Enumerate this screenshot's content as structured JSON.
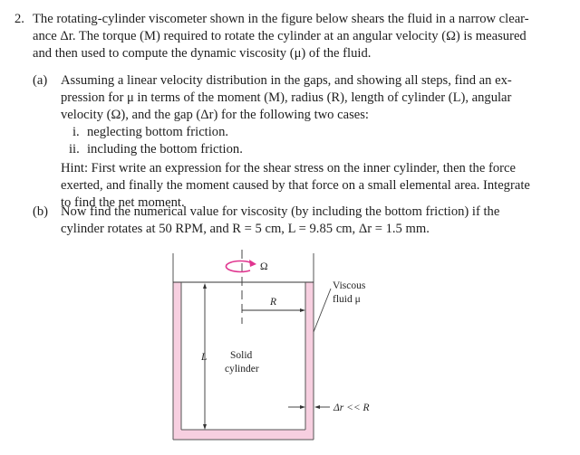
{
  "problem": {
    "number": "2.",
    "intro_lines": [
      "The rotating-cylinder viscometer shown in the figure below shears the fluid in a narrow clear-",
      "ance Δr. The torque (M) required to rotate the cylinder at an angular velocity (Ω) is measured",
      "and then used to compute the dynamic viscosity (μ) of the fluid."
    ],
    "part_a": {
      "label": "(a)",
      "lines": [
        "Assuming a linear velocity distribution in the gaps, and showing all steps, find an ex-",
        "pression for μ in terms of the moment (M), radius (R), length of cylinder (L), angular",
        "velocity (Ω), and the gap (Δr) for the following two cases:"
      ],
      "cases": [
        {
          "label": "i.",
          "text": "neglecting bottom friction."
        },
        {
          "label": "ii.",
          "text": "including the bottom friction."
        }
      ],
      "hint_lines": [
        "Hint: First write an expression for the shear stress on the inner cylinder, then the force",
        "exerted, and finally the moment caused by that force on a small elemental area. Integrate",
        "to find the net moment."
      ]
    },
    "part_b": {
      "label": "(b)",
      "lines": [
        "Now find the numerical value for viscosity (by including the bottom friction) if the",
        "cylinder rotates at 50 RPM, and R = 5 cm, L = 9.85 cm, Δr = 1.5 mm."
      ]
    }
  },
  "figure": {
    "omega_label": "Ω",
    "radius_label": "R",
    "length_label": "L",
    "fluid_label_line1": "Viscous",
    "fluid_label_line2": "fluid μ",
    "cylinder_label_line1": "Solid",
    "cylinder_label_line2": "cylinder",
    "gap_label": "Δr << R",
    "colors": {
      "fluid": "#F7CFE0",
      "rotation_arrow": "#E0358F",
      "lines": "#333333"
    },
    "icons": [
      "rotation-arrow-icon",
      "dimension-arrow-icon"
    ]
  }
}
